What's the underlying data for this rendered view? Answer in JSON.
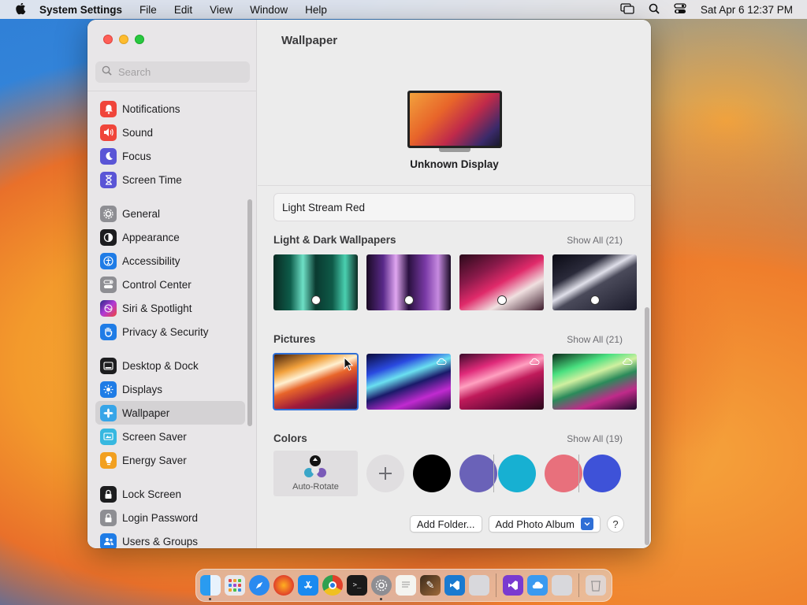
{
  "menubar": {
    "app_name": "System Settings",
    "menus": [
      "File",
      "Edit",
      "View",
      "Window",
      "Help"
    ],
    "clock": "Sat Apr 6  12:37 PM"
  },
  "sidebar": {
    "search_placeholder": "Search",
    "groups": [
      [
        {
          "label": "Notifications",
          "icon": "bell-icon",
          "color": "#f0453a"
        },
        {
          "label": "Sound",
          "icon": "speaker-icon",
          "color": "#f0453a"
        },
        {
          "label": "Focus",
          "icon": "moon-icon",
          "color": "#5a55d6"
        },
        {
          "label": "Screen Time",
          "icon": "hourglass-icon",
          "color": "#5a55d6"
        }
      ],
      [
        {
          "label": "General",
          "icon": "gear-icon",
          "color": "#8e8e93"
        },
        {
          "label": "Appearance",
          "icon": "appearance-icon",
          "color": "#1d1d1f"
        },
        {
          "label": "Accessibility",
          "icon": "accessibility-icon",
          "color": "#1f7ce6"
        },
        {
          "label": "Control Center",
          "icon": "control-center-icon",
          "color": "#8e8e93"
        },
        {
          "label": "Siri & Spotlight",
          "icon": "siri-icon",
          "color": "#b23ad6"
        },
        {
          "label": "Privacy & Security",
          "icon": "hand-icon",
          "color": "#1f7ce6"
        }
      ],
      [
        {
          "label": "Desktop & Dock",
          "icon": "dock-icon",
          "color": "#1d1d1f"
        },
        {
          "label": "Displays",
          "icon": "sun-icon",
          "color": "#1f7ce6"
        },
        {
          "label": "Wallpaper",
          "icon": "wallpaper-icon",
          "color": "#37a5e8",
          "selected": true
        },
        {
          "label": "Screen Saver",
          "icon": "screen-saver-icon",
          "color": "#37b8e0"
        },
        {
          "label": "Energy Saver",
          "icon": "battery-icon",
          "color": "#f2a020"
        }
      ],
      [
        {
          "label": "Lock Screen",
          "icon": "lock-icon",
          "color": "#1d1d1f"
        },
        {
          "label": "Login Password",
          "icon": "padlock-icon",
          "color": "#8e8e93"
        },
        {
          "label": "Users & Groups",
          "icon": "users-icon",
          "color": "#1f7ce6"
        }
      ]
    ]
  },
  "main": {
    "title": "Wallpaper",
    "display_name": "Unknown Display",
    "current_wallpaper": "Light Stream Red",
    "sections": {
      "light_dark": {
        "title": "Light & Dark Wallpapers",
        "show_all": "Show All (21)"
      },
      "pictures": {
        "title": "Pictures",
        "show_all": "Show All (21)"
      },
      "colors": {
        "title": "Colors",
        "show_all": "Show All (19)",
        "auto_rotate": "Auto-Rotate",
        "swatches": [
          "#000000",
          "#6a62b8",
          "#17b0d2",
          "#e8707c",
          "#3e52d8"
        ]
      }
    },
    "buttons": {
      "add_folder": "Add Folder...",
      "add_album": "Add Photo Album",
      "help": "?"
    }
  },
  "dock": {
    "apps": [
      "Finder",
      "Launchpad",
      "Safari",
      "Firefox",
      "App Store",
      "Chrome",
      "Terminal",
      "System Settings",
      "TextEdit",
      "Pixelmator",
      "VS Code",
      "Preview",
      "Visual Studio",
      "iCloud",
      "Photos",
      "Trash"
    ]
  }
}
